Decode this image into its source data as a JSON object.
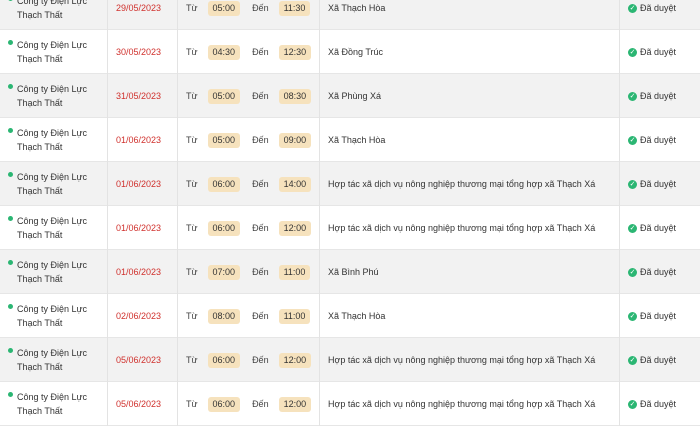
{
  "labels": {
    "from": "Từ",
    "to": "Đến"
  },
  "colors": {
    "accent_green": "#2bb673",
    "date_red": "#d0312d",
    "chip_bg": "#f6e2bd"
  },
  "rows": [
    {
      "unit": "Công ty Điện Lực Thạch Thất",
      "date": "29/05/2023",
      "start": "05:00",
      "end": "11:30",
      "area": "Xã Thạch Hòa",
      "status": "Đã duyệt"
    },
    {
      "unit": "Công ty Điện Lực Thạch Thất",
      "date": "30/05/2023",
      "start": "04:30",
      "end": "12:30",
      "area": "Xã Đồng Trúc",
      "status": "Đã duyệt"
    },
    {
      "unit": "Công ty Điện Lực Thạch Thất",
      "date": "31/05/2023",
      "start": "05:00",
      "end": "08:30",
      "area": "Xã Phùng Xá",
      "status": "Đã duyệt"
    },
    {
      "unit": "Công ty Điện Lực Thạch Thất",
      "date": "01/06/2023",
      "start": "05:00",
      "end": "09:00",
      "area": "Xã Thạch Hòa",
      "status": "Đã duyệt"
    },
    {
      "unit": "Công ty Điện Lực Thạch Thất",
      "date": "01/06/2023",
      "start": "06:00",
      "end": "14:00",
      "area": "Hợp tác xã dịch vụ nông nghiệp thương mại tổng hợp xã Thạch Xá",
      "status": "Đã duyệt"
    },
    {
      "unit": "Công ty Điện Lực Thạch Thất",
      "date": "01/06/2023",
      "start": "06:00",
      "end": "12:00",
      "area": "Hợp tác xã dịch vụ nông nghiệp thương mại tổng hợp xã Thạch Xá",
      "status": "Đã duyệt"
    },
    {
      "unit": "Công ty Điện Lực Thạch Thất",
      "date": "01/06/2023",
      "start": "07:00",
      "end": "11:00",
      "area": "Xã Bình Phú",
      "status": "Đã duyệt"
    },
    {
      "unit": "Công ty Điện Lực Thạch Thất",
      "date": "02/06/2023",
      "start": "08:00",
      "end": "11:00",
      "area": "Xã Thạch Hòa",
      "status": "Đã duyệt"
    },
    {
      "unit": "Công ty Điện Lực Thạch Thất",
      "date": "05/06/2023",
      "start": "06:00",
      "end": "12:00",
      "area": "Hợp tác xã dịch vụ nông nghiệp thương mại tổng hợp xã Thạch Xá",
      "status": "Đã duyệt"
    },
    {
      "unit": "Công ty Điện Lực Thạch Thất",
      "date": "05/06/2023",
      "start": "06:00",
      "end": "12:00",
      "area": "Hợp tác xã dịch vụ nông nghiệp thương mại tổng hợp xã Thạch Xá",
      "status": "Đã duyệt"
    }
  ]
}
